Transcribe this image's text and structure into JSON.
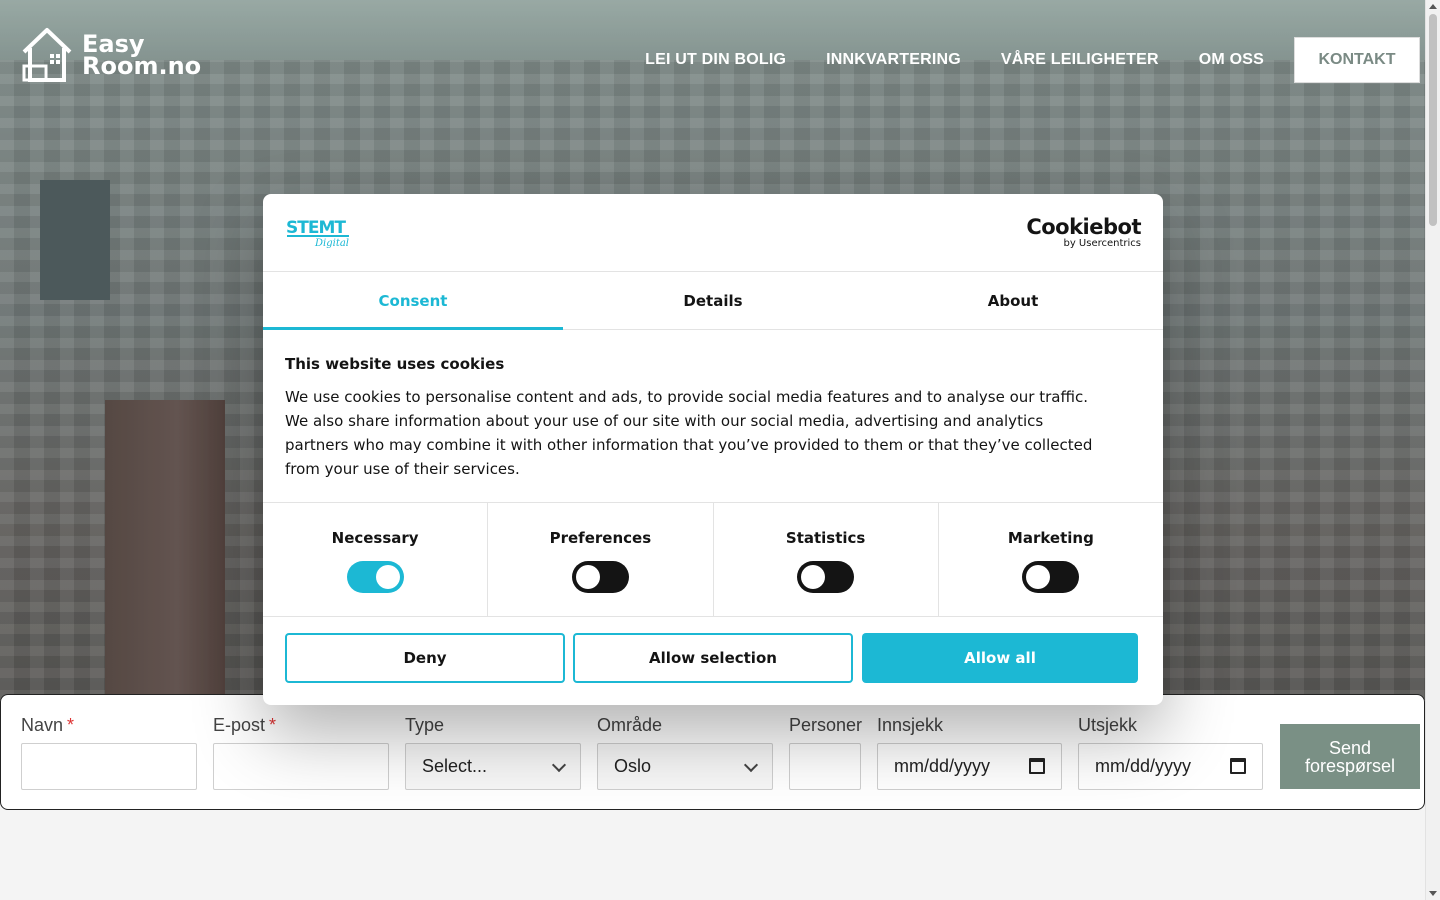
{
  "brand": {
    "logo_line1": "Easy",
    "logo_line2": "Room.no"
  },
  "nav": {
    "items": [
      "LEI UT DIN BOLIG",
      "INNKVARTERING",
      "VÅRE LEILIGHETER",
      "OM OSS"
    ],
    "cta": "KONTAKT"
  },
  "booking": {
    "name_label": "Navn",
    "email_label": "E-post",
    "required_mark": "*",
    "type_label": "Type",
    "type_value": "Select...",
    "area_label": "Område",
    "area_value": "Oslo",
    "persons_label": "Personer",
    "checkin_label": "Innsjekk",
    "checkin_value": "mm/dd/yyyy",
    "checkout_label": "Utsjekk",
    "checkout_value": "mm/dd/yyyy",
    "submit_label": "Send forespørsel"
  },
  "cookie": {
    "brand_logo": "STEMT Digital",
    "provider_name": "Cookiebot",
    "provider_sub": "by Usercentrics",
    "tabs": [
      "Consent",
      "Details",
      "About"
    ],
    "active_tab": "Consent",
    "title": "This website uses cookies",
    "text": "We use cookies to personalise content and ads, to provide social media features and to analyse our traffic. We also share information about your use of our site with our social media, advertising and analytics partners who may combine it with other information that you’ve provided to them or that they’ve collected from your use of their services.",
    "categories": [
      {
        "label": "Necessary",
        "on": true
      },
      {
        "label": "Preferences",
        "on": false
      },
      {
        "label": "Statistics",
        "on": false
      },
      {
        "label": "Marketing",
        "on": false
      }
    ],
    "deny_label": "Deny",
    "allow_selection_label": "Allow selection",
    "allow_all_label": "Allow all",
    "accent_color": "#1cb8d4"
  }
}
